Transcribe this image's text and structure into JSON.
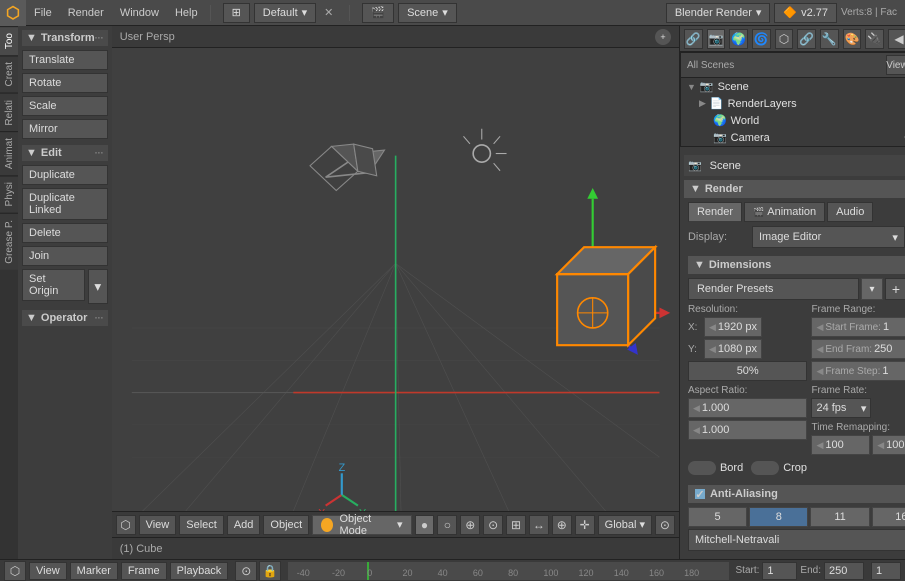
{
  "topbar": {
    "logo": "⬡",
    "menus": [
      "File",
      "Render",
      "Window",
      "Help"
    ],
    "layout_icon": "⊞",
    "layout": "Default",
    "scene_icon": "🎬",
    "scene": "Scene",
    "engine": "Blender Render",
    "version": "v2.77",
    "stats": "Verts:8 | Fac"
  },
  "sidebar": {
    "tabs": [
      "Too",
      "Creat",
      "Relati",
      "Animat",
      "Physi",
      "Grease P."
    ],
    "transform": {
      "label": "Transform",
      "buttons": [
        "Translate",
        "Rotate",
        "Scale",
        "Mirror"
      ]
    },
    "edit": {
      "label": "Edit",
      "buttons": [
        "Duplicate",
        "Duplicate Linked",
        "Delete",
        "Join"
      ],
      "set_origin": "Set Origin"
    },
    "operator": {
      "label": "Operator"
    }
  },
  "viewport": {
    "label": "User Persp",
    "object_label": "(1) Cube",
    "toolbar": {
      "view": "View",
      "select": "Select",
      "add": "Add",
      "object": "Object",
      "mode": "Object Mode",
      "shading_icon": "●",
      "transform_icon": "⊕",
      "global": "Global",
      "snap_icon": "⊙"
    }
  },
  "right_panel": {
    "scene_label": "Scene",
    "tabs_icons": [
      "🔗",
      "📷",
      "🌍",
      "🌀",
      "⬡",
      "🔗",
      "🔧",
      "🎨",
      "🔌"
    ],
    "scene_tree": {
      "scene": "Scene",
      "render_layers": "RenderLayers",
      "world": "World",
      "camera": "Camera"
    },
    "properties": {
      "scene_label": "Scene",
      "render_label": "Render",
      "render_btn": "Render",
      "animation_btn": "Animation",
      "audio_btn": "Audio",
      "display_label": "Display:",
      "display_value": "Image Editor",
      "dimensions_label": "Dimensions",
      "render_presets": "Render Presets",
      "resolution_label": "Resolution:",
      "res_x_label": "X:",
      "res_x": "1920 px",
      "res_y_label": "Y:",
      "res_y": "1080 px",
      "res_percent": "50%",
      "aspect_ratio_label": "Aspect Ratio:",
      "aspect_x": "1.000",
      "aspect_y": "1.000",
      "bord_label": "Bord",
      "crop_label": "Crop",
      "frame_range_label": "Frame Range:",
      "start_frame_label": "Start Frame:",
      "start_frame": "1",
      "end_frame_label": "End Fram:",
      "end_frame": "250",
      "frame_step_label": "Frame Step:",
      "frame_step": "1",
      "frame_rate_label": "Frame Rate:",
      "fps": "24 fps",
      "time_remapping_label": "Time Remapping:",
      "time_old": "100",
      "time_new": "100",
      "anti_aliasing_label": "Anti-Aliasing",
      "aa_values": [
        "5",
        "8",
        "11",
        "16"
      ],
      "aa_filter": "Mitchell-Netravali"
    }
  },
  "bottom": {
    "scene_icon": "⬡",
    "view_btn": "View",
    "marker_btn": "Marker",
    "frame_btn": "Frame",
    "playback_btn": "Playback",
    "lock_icon": "🔒",
    "start_label": "Start:",
    "start_val": "1",
    "end_label": "End:",
    "end_val": "250",
    "current_frame": "1"
  }
}
